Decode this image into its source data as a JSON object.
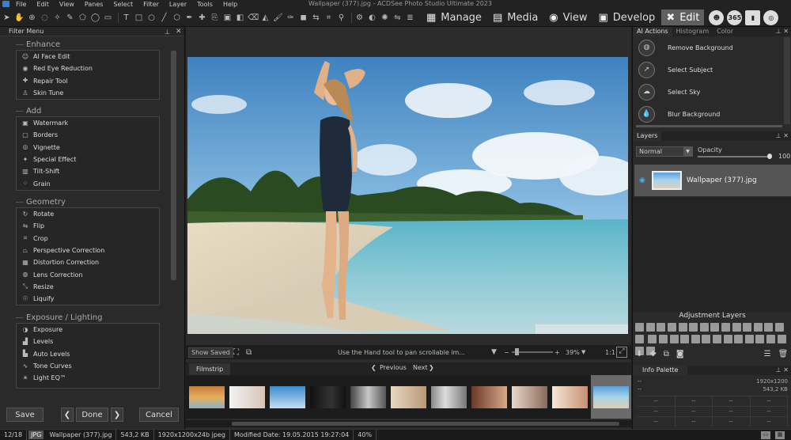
{
  "window": {
    "title": "Wallpaper (377).jpg - ACDSee Photo Studio Ultimate 2023"
  },
  "menu": [
    "File",
    "Edit",
    "View",
    "Panes",
    "Select",
    "Filter",
    "Layer",
    "Tools",
    "Help"
  ],
  "modes": [
    {
      "label": "Manage",
      "icon": "grid-icon",
      "active": false
    },
    {
      "label": "Media",
      "icon": "media-icon",
      "active": false
    },
    {
      "label": "View",
      "icon": "eye-icon",
      "active": false
    },
    {
      "label": "Develop",
      "icon": "develop-icon",
      "active": false
    },
    {
      "label": "Edit",
      "icon": "edit-tools-icon",
      "active": true
    }
  ],
  "extra_mode_icons": {
    "face": "",
    "365": "365"
  },
  "filter_menu": {
    "title": "Filter Menu",
    "groups": [
      {
        "title": "Enhance",
        "items": [
          "AI Face Edit",
          "Red Eye Reduction",
          "Repair Tool",
          "Skin Tune"
        ]
      },
      {
        "title": "Add",
        "items": [
          "Watermark",
          "Borders",
          "Vignette",
          "Special Effect",
          "Tilt-Shift",
          "Grain"
        ]
      },
      {
        "title": "Geometry",
        "items": [
          "Rotate",
          "Flip",
          "Crop",
          "Perspective Correction",
          "Distortion Correction",
          "Lens Correction",
          "Resize",
          "Liquify"
        ]
      },
      {
        "title": "Exposure / Lighting",
        "items": [
          "Exposure",
          "Levels",
          "Auto Levels",
          "Tone Curves",
          "Light EQ™"
        ]
      }
    ]
  },
  "left_buttons": {
    "save": "Save",
    "done": "Done",
    "cancel": "Cancel"
  },
  "status_line": {
    "show_saved": "Show Saved",
    "hint": "Use the Hand tool to pan scrollable im...",
    "zoom": "39%",
    "ratio": "1:1"
  },
  "filmstrip": {
    "tab": "Filmstrip",
    "prev": "Previous",
    "next": "Next"
  },
  "right_panel": {
    "tabs": [
      "AI Actions",
      "Histogram",
      "Color"
    ],
    "ai_actions": [
      "Remove Background",
      "Select Subject",
      "Select Sky",
      "Blur Background"
    ],
    "layers": {
      "tab": "Layers",
      "blend_mode": "Normal",
      "opacity_label": "Opacity",
      "opacity_value": "100",
      "layer_name": "Wallpaper (377).jpg"
    },
    "adjustment_layers_title": "Adjustment Layers",
    "info_palette": {
      "tab": "Info Palette",
      "rows": [
        [
          "--",
          "1920x1200"
        ],
        [
          "--",
          "543,2 KB"
        ]
      ],
      "grid": [
        [
          "--",
          "--",
          "--",
          "--"
        ],
        [
          "--",
          "--",
          "--",
          "--"
        ],
        [
          "--",
          "--",
          "--",
          "--"
        ]
      ]
    }
  },
  "bottom_status": {
    "position": "12/18",
    "format": "JPG",
    "filename": "Wallpaper (377).jpg",
    "size": "543,2 KB",
    "dimensions": "1920x1200x24b jpeg",
    "modified": "Modified Date: 19.05.2015 19:27:04",
    "zoom": "40%"
  }
}
